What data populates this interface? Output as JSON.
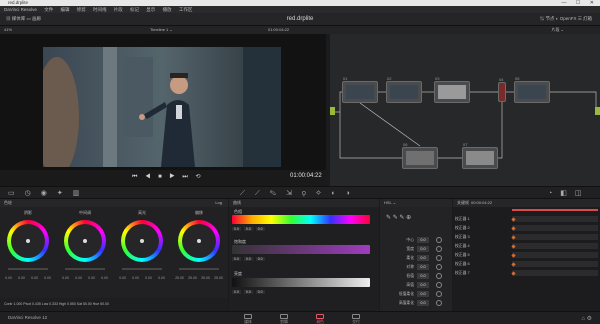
{
  "window": {
    "title": "red.drplite",
    "controls": "— ☐ ✕"
  },
  "menubar": [
    "DaVinci Resolve",
    "文件",
    "编辑",
    "修剪",
    "时间线",
    "片段",
    "标记",
    "显示",
    "播放",
    "工作区"
  ],
  "toolbar": {
    "title": "red.drplite",
    "left": "▦  媒体库     ▭  画廊",
    "right": "⇅ 节点     ◐ OpenFX     ☰ 灯箱"
  },
  "viewer": {
    "title": "Timeline 1 ⌄",
    "timecode_top": "01:00:04:22",
    "zoom": "41%",
    "timecode": "01:00:04:22"
  },
  "nodegraph": {
    "label": "片段 ⌄",
    "nodes": [
      "01",
      "02",
      "03",
      "04",
      "05",
      "06",
      "07"
    ]
  },
  "wheels": {
    "header": "色轮",
    "mode": "Log",
    "items": [
      {
        "label": "阴影",
        "vals": [
          "0.00",
          "0.00",
          "0.00",
          "0.00"
        ]
      },
      {
        "label": "中间调",
        "vals": [
          "0.00",
          "0.00",
          "0.00",
          "0.00"
        ]
      },
      {
        "label": "高光",
        "vals": [
          "0.00",
          "0.00",
          "0.00",
          "0.00"
        ]
      },
      {
        "label": "偏移",
        "vals": [
          "25.00",
          "25.00",
          "25.00",
          "25.00"
        ]
      }
    ],
    "footer": "Contr 1.000   Pivot 0.435   Low 0.333   High 0.550   Sat 50.00   Hue 50.00"
  },
  "curves": {
    "header": "曲线",
    "sections": [
      {
        "title": "色相",
        "fields": [
          "0.0",
          "0.0",
          "0.0"
        ]
      },
      {
        "title": "饱和度",
        "fields": [
          "0.0",
          "0.0",
          "0.0"
        ]
      },
      {
        "title": "亮度",
        "fields": [
          "0.0",
          "0.0",
          "0.0"
        ]
      }
    ]
  },
  "hsl": {
    "header": "HSL ⌄",
    "rows": [
      {
        "label": "中心",
        "value": "0.0"
      },
      {
        "label": "宽度",
        "value": "0.0"
      },
      {
        "label": "柔化",
        "value": "0.0"
      },
      {
        "label": "对称",
        "value": "0.0"
      },
      {
        "label": "低值",
        "value": "0.0"
      },
      {
        "label": "高值",
        "value": "0.0"
      },
      {
        "label": "低值柔化",
        "value": "0.0"
      },
      {
        "label": "高值柔化",
        "value": "0.0"
      }
    ]
  },
  "keyframes": {
    "header": "关键帧",
    "timecode": "00:00:04:22",
    "rows": [
      "校正器 1",
      "校正器 2",
      "校正器 3",
      "校正器 4",
      "校正器 5",
      "校正器 6",
      "校正器 7"
    ]
  },
  "pagebar": {
    "app": "DaVinci Resolve 12",
    "pages": [
      {
        "label": "媒体",
        "active": false
      },
      {
        "label": "剪辑",
        "active": false
      },
      {
        "label": "调色",
        "active": true
      },
      {
        "label": "交付",
        "active": false
      }
    ]
  }
}
